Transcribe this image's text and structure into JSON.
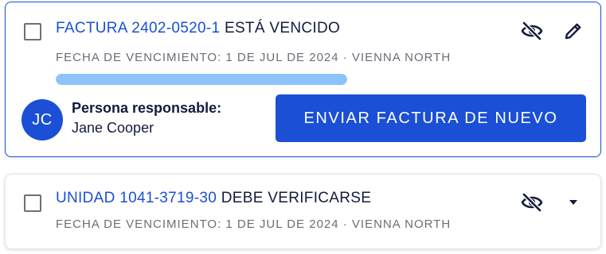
{
  "cards": [
    {
      "ref_label": "FACTURA 2402-0520-1",
      "status_text": "ESTÁ VENCIDO",
      "meta": "FECHA DE VENCIMIENTO: 1 DE JUL DE 2024 · VIENNA NORTH",
      "progress": 0.49,
      "checked": false,
      "icons": [
        "eye-off-icon",
        "pencil-icon"
      ],
      "responsible": {
        "initials": "JC",
        "label": "Persona responsable:",
        "name": "Jane Cooper"
      },
      "action_label": "ENVIAR FACTURA DE NUEVO",
      "selected": true
    },
    {
      "ref_label": "UNIDAD 1041-3719-30",
      "status_text": "DEBE VERIFICARSE",
      "meta": "FECHA DE VENCIMIENTO: 1 DE JUL DE 2024 · VIENNA NORTH",
      "checked": false,
      "icons": [
        "eye-off-icon",
        "caret-down-icon"
      ],
      "selected": false
    }
  ],
  "colors": {
    "accent": "#1a4fd6",
    "progress_fill": "#8ec3fa",
    "text_primary": "#141b3c",
    "text_muted": "#6b6e78"
  }
}
